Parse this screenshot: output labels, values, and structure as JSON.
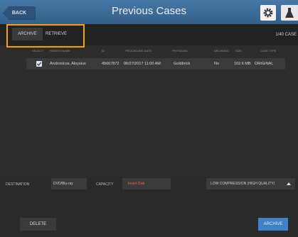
{
  "header": {
    "back_label": "BACK",
    "title": "Previous Cases"
  },
  "tabs": {
    "archive": "ARCHIVE",
    "retrieve": "RETRIEVE",
    "case_count": "1/40 CASE"
  },
  "columns": [
    "SELECT",
    "PATIENT NAME",
    "ID",
    "PROCEDURE DATE",
    "PHYSICIAN",
    "ARCHIVED",
    "SIZE",
    "CASE TYPE"
  ],
  "rows": [
    {
      "patient": "Andronicos, Aloysius",
      "id": "45667872",
      "date": "06/27/2017 11:00 AM",
      "physician": "Goldbrick",
      "archived": "No",
      "size": "102.6 MB",
      "case_type": "ORIGINAL",
      "selected": true
    }
  ],
  "bottom": {
    "destination_label": "DESTINATION",
    "destination_value": "DVD/Blu-ray",
    "capacity_label": "CAPACITY",
    "capacity_value": "Insert Disk",
    "compression_value": "LOW COMPRESSION (HIGH QUALITY)",
    "delete_label": "DELETE",
    "archive_label": "ARCHIVE"
  },
  "icons": [
    "chevron-left-icon",
    "gear-icon",
    "flask-icon",
    "checkmark-icon",
    "caret-up-icon"
  ],
  "colors": {
    "header": "#3d6d9c",
    "highlight": "#f5a10c",
    "archive_button": "#3f7fc6",
    "capacity_text": "#e46a4a"
  }
}
